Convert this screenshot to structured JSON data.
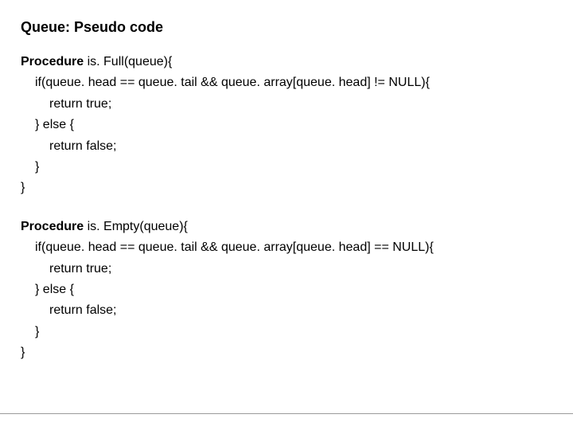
{
  "title": "Queue: Pseudo code",
  "proc1": {
    "kw": "Procedure",
    "sig": " is. Full(queue){",
    "l2": "if(queue. head == queue. tail && queue. array[queue. head] != NULL){",
    "l3": "return true;",
    "l4": "} else {",
    "l5": "return false;",
    "l6": "}",
    "l7": "}"
  },
  "proc2": {
    "kw": "Procedure",
    "sig": " is. Empty(queue){",
    "l2": "if(queue. head == queue. tail && queue. array[queue. head] == NULL){",
    "l3": "return true;",
    "l4": "} else {",
    "l5": "return false;",
    "l6": "}",
    "l7": "}"
  }
}
